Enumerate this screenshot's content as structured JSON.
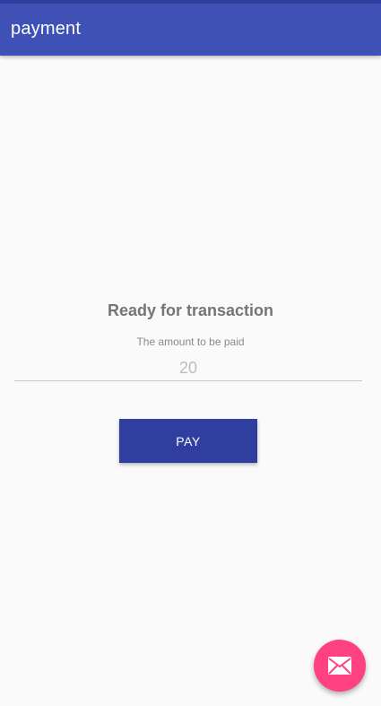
{
  "app_bar": {
    "title": "payment"
  },
  "main": {
    "heading": "Ready for transaction",
    "amount_label": "The amount to be paid",
    "amount_value": "20",
    "pay_button_label": "PAY"
  },
  "fab": {
    "icon": "email-icon"
  },
  "colors": {
    "primary": "#3f51b5",
    "primary_dark": "#303f9f",
    "accent": "#ff4081",
    "background": "#fafafa"
  }
}
